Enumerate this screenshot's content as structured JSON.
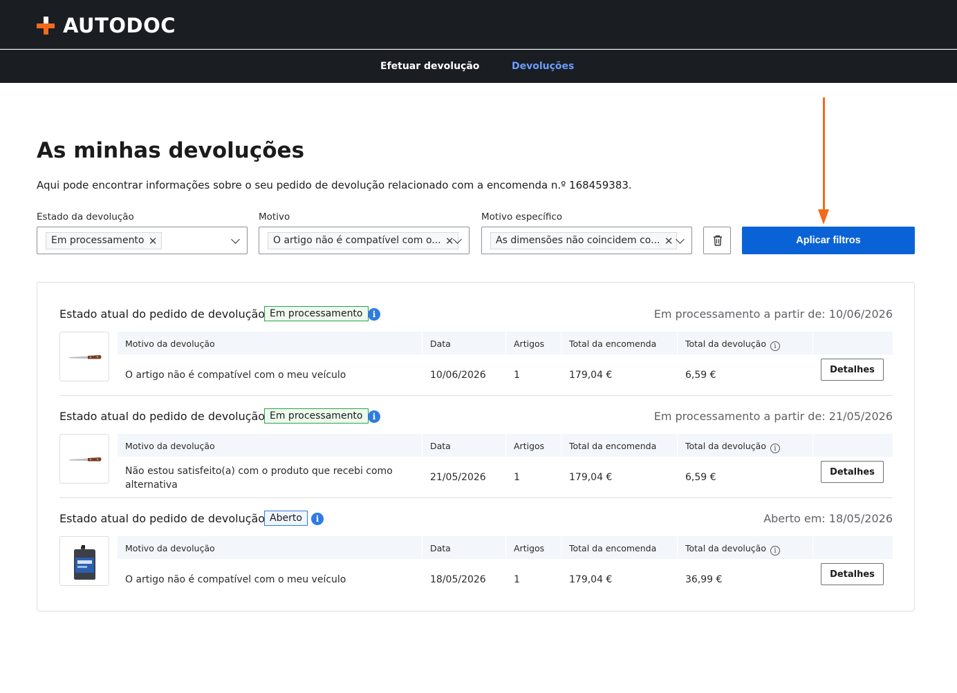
{
  "header": {
    "logo_text": "AUTODOC",
    "nav": [
      {
        "label": "Efetuar devolução"
      },
      {
        "label": "Devoluções"
      }
    ]
  },
  "page": {
    "title": "As minhas devoluções",
    "subtitle": "Aqui pode encontrar informações sobre o seu pedido de devolução relacionado com a encomenda n.º 168459383."
  },
  "filters": {
    "status": {
      "label": "Estado da devolução",
      "chip": "Em processamento"
    },
    "reason": {
      "label": "Motivo",
      "chip": "O artigo não é compatível com o..."
    },
    "specific": {
      "label": "Motivo específico",
      "chip": "As dimensões não coincidem co..."
    },
    "apply_label": "Aplicar filtros"
  },
  "table_headers": {
    "reason": "Motivo da devolução",
    "date": "Data",
    "items": "Artigos",
    "order_total": "Total da encomenda",
    "return_total": "Total da devolução"
  },
  "returns": [
    {
      "state_label": "Estado atual do pedido de devolução",
      "badge": "Em processamento",
      "since": "Em processamento a partir de: 10/06/2026",
      "reason": "O artigo não é compatível com o meu veículo",
      "date": "10/06/2026",
      "items": "1",
      "order_total": "179,04 €",
      "return_total": "6,59 €",
      "details_label": "Detalhes",
      "product_icon": "knife-icon"
    },
    {
      "state_label": "Estado atual do pedido de devolução",
      "badge": "Em processamento",
      "since": "Em processamento a partir de: 21/05/2026",
      "reason": "Não estou satisfeito(a) com o produto que recebi como alternativa",
      "date": "21/05/2026",
      "items": "1",
      "order_total": "179,04 €",
      "return_total": "6,59 €",
      "details_label": "Detalhes",
      "product_icon": "knife-icon"
    },
    {
      "state_label": "Estado atual do pedido de devolução",
      "badge": "Aberto",
      "since": "Aberto em: 18/05/2026",
      "reason": "O artigo não é compatível com o meu veículo",
      "date": "18/05/2026",
      "items": "1",
      "order_total": "179,04 €",
      "return_total": "36,99 €",
      "details_label": "Detalhes",
      "product_icon": "oil-canister-icon"
    }
  ],
  "colors": {
    "accent": "#0a63d6",
    "brand_orange": "#f26a1b",
    "header_bg": "#1a1d22",
    "nav_active": "#6b9dff",
    "badge_green": "#2ba34a",
    "badge_blue": "#2f7be0"
  }
}
